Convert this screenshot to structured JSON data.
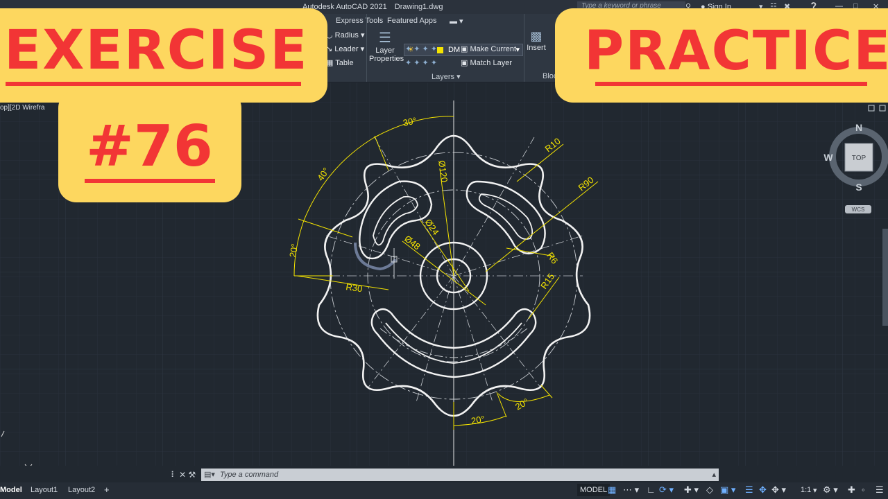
{
  "titlebar": {
    "app_title": "Autodesk AutoCAD 2021",
    "file_name": "Drawing1.dwg",
    "search_placeholder": "Type a keyword or phrase",
    "signin": "Sign In"
  },
  "ribbon": {
    "tabs": [
      "Express Tools",
      "Featured Apps"
    ],
    "annotation": {
      "radius": "Radius",
      "leader": "Leader",
      "table": "Table"
    },
    "layers": {
      "layer_properties": "Layer Properties",
      "current_layer": "DM",
      "make_current": "Make Current",
      "match_layer": "Match Layer",
      "panel_title": "Layers"
    },
    "block": {
      "insert": "Insert",
      "panel_title": "Bloc"
    }
  },
  "viewport": {
    "label": "op][2D Wirefra"
  },
  "overlays": {
    "left_title": "EXERCISE",
    "left_number": "#76",
    "right_title": "PRACTICE"
  },
  "drawing": {
    "dimensions": [
      "30°",
      "40°",
      "20°",
      "R30",
      "R10",
      "R90",
      "Ø120",
      "Ø24",
      "Ø48",
      "R6",
      "R15",
      "20°",
      "20°"
    ]
  },
  "viewcube": {
    "n": "N",
    "s": "S",
    "w": "W",
    "top": "TOP",
    "wcs": "WCS"
  },
  "command": {
    "placeholder": "Type a command"
  },
  "status": {
    "tabs": [
      "Model",
      "Layout1",
      "Layout2"
    ],
    "model": "MODEL",
    "scale": "1:1"
  },
  "colors": {
    "background": "#212830",
    "badge": "#fdd75f",
    "badge_text": "#f23535",
    "dimension": "#f5e400"
  }
}
